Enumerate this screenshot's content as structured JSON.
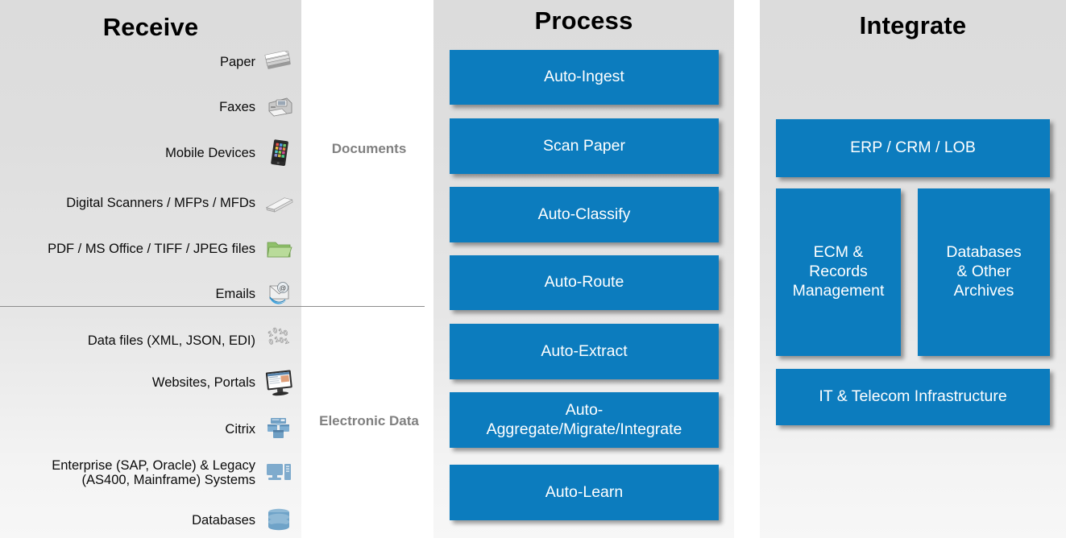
{
  "colors": {
    "box_blue": "#0c7cbe",
    "panel_gray_top": "#dcdcdc",
    "panel_gray_bottom": "#f7f7f7",
    "category_label_gray": "#808080",
    "divider_gray": "#8d8d8d",
    "text_dark": "#0a0a0a",
    "box_text": "#ffffff"
  },
  "columns": {
    "receive": {
      "title": "Receive",
      "category_documents": "Documents",
      "category_electronic": "Electronic\nData",
      "items": [
        {
          "label": "Paper",
          "icon": "paper-stack-icon",
          "group": "documents"
        },
        {
          "label": "Faxes",
          "icon": "fax-machine-icon",
          "group": "documents"
        },
        {
          "label": "Mobile Devices",
          "icon": "mobile-tablet-icon",
          "group": "documents"
        },
        {
          "label": "Digital Scanners / MFPs / MFDs",
          "icon": "flatbed-scanner-icon",
          "group": "documents"
        },
        {
          "label": "PDF / MS Office / TIFF / JPEG files",
          "icon": "green-folder-icon",
          "group": "documents"
        },
        {
          "label": "Emails",
          "icon": "email-envelope-icon",
          "group": "documents"
        },
        {
          "label": "Data files (XML, JSON, EDI)",
          "icon": "binary-data-icon",
          "group": "electronic"
        },
        {
          "label": "Websites, Portals",
          "icon": "desktop-monitor-icon",
          "group": "electronic"
        },
        {
          "label": "Citrix",
          "icon": "citrix-windows-icon",
          "group": "electronic"
        },
        {
          "label": "Enterprise (SAP, Oracle) & Legacy\n(AS400, Mainframe) Systems",
          "icon": "server-workstation-icon",
          "group": "electronic"
        },
        {
          "label": "Databases",
          "icon": "database-cylinder-icon",
          "group": "electronic"
        }
      ]
    },
    "process": {
      "title": "Process",
      "items": [
        {
          "label": "Auto-Ingest"
        },
        {
          "label": "Scan Paper"
        },
        {
          "label": "Auto-Classify"
        },
        {
          "label": "Auto-Route"
        },
        {
          "label": "Auto-Extract"
        },
        {
          "label": "Auto-\nAggregate/Migrate/Integrate"
        },
        {
          "label": "Auto-Learn"
        }
      ]
    },
    "integrate": {
      "title": "Integrate",
      "items": [
        {
          "label": "ERP / CRM / LOB"
        },
        {
          "label": "ECM &\nRecords\nManagement"
        },
        {
          "label": "Databases\n& Other\nArchives"
        },
        {
          "label": "IT & Telecom Infrastructure"
        }
      ]
    }
  }
}
